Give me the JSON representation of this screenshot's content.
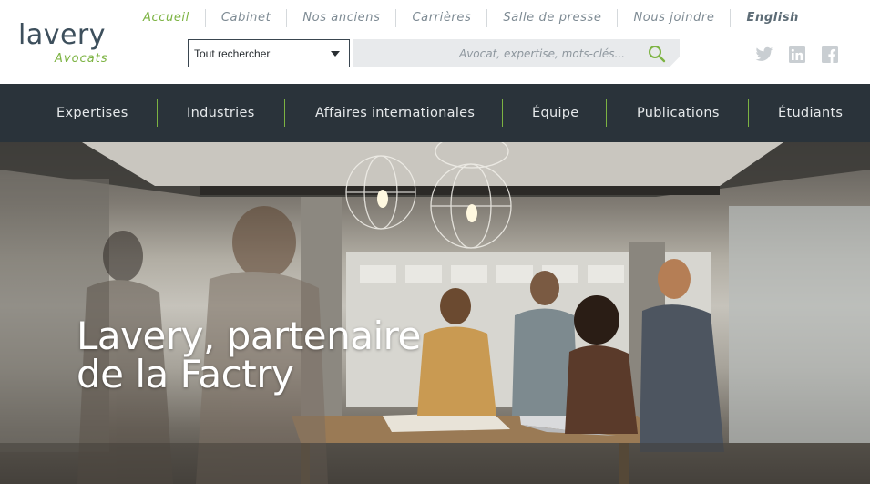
{
  "brand": {
    "name": "lavery",
    "tagline": "Avocats",
    "accent": "#7cb342",
    "logo_color": "#3d4f5c"
  },
  "top_nav": [
    {
      "label": "Accueil",
      "active": true
    },
    {
      "label": "Cabinet"
    },
    {
      "label": "Nos anciens"
    },
    {
      "label": "Carrières"
    },
    {
      "label": "Salle de presse"
    },
    {
      "label": "Nous joindre"
    },
    {
      "label": "English"
    }
  ],
  "search": {
    "scope_selected": "Tout rechercher",
    "placeholder": "Avocat, expertise, mots-clés...",
    "icon": "search-icon"
  },
  "social": [
    "twitter-icon",
    "linkedin-icon",
    "facebook-icon"
  ],
  "main_nav": [
    {
      "label": "Expertises"
    },
    {
      "label": "Industries"
    },
    {
      "label": "Affaires internationales"
    },
    {
      "label": "Équipe"
    },
    {
      "label": "Publications"
    },
    {
      "label": "Étudiants"
    }
  ],
  "hero": {
    "title_line1": "Lavery, partenaire",
    "title_line2": "de la Factry"
  },
  "colors": {
    "nav_bg": "#2a333a",
    "search_bg": "#e8eaec"
  }
}
